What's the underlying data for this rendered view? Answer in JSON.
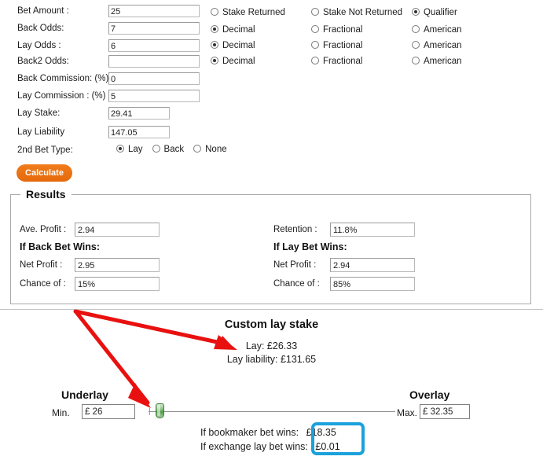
{
  "form": {
    "rows": [
      {
        "label": "Bet Amount :",
        "value": "25",
        "input_name": "bet-amount-input",
        "wide": false
      },
      {
        "label": "Back Odds:",
        "value": "7",
        "input_name": "back-odds-input",
        "wide": false
      },
      {
        "label": "Lay Odds :",
        "value": "6",
        "input_name": "lay-odds-input",
        "wide": false
      },
      {
        "label": "Back2 Odds:",
        "value": "",
        "input_name": "back2-odds-input",
        "wide": false
      },
      {
        "label": "Back Commission: (%)",
        "value": "0",
        "input_name": "back-commission-input",
        "wide": false
      },
      {
        "label": "Lay Commission : (%)",
        "value": "5",
        "input_name": "lay-commission-input",
        "wide": false
      },
      {
        "label": "Lay Stake:",
        "value": "29.41",
        "input_name": "lay-stake-input",
        "wide": true
      },
      {
        "label": "Lay Liability",
        "value": "147.05",
        "input_name": "lay-liability-input",
        "wide": true
      }
    ],
    "radio_rows": [
      {
        "a": "Stake Returned",
        "a_on": false,
        "b": "Stake Not Returned",
        "b_on": false,
        "c": "Qualifier",
        "c_on": true
      },
      {
        "a": "Decimal",
        "a_on": true,
        "b": "Fractional",
        "b_on": false,
        "c": "American",
        "c_on": false
      },
      {
        "a": "Decimal",
        "a_on": true,
        "b": "Fractional",
        "b_on": false,
        "c": "American",
        "c_on": false
      },
      {
        "a": "Decimal",
        "a_on": true,
        "b": "Fractional",
        "b_on": false,
        "c": "American",
        "c_on": false
      }
    ],
    "second_bet_type": {
      "label": "2nd Bet Type:",
      "options": [
        {
          "label": "Lay",
          "selected": true
        },
        {
          "label": "Back",
          "selected": false
        },
        {
          "label": "None",
          "selected": false
        }
      ]
    }
  },
  "calculate_button": {
    "label": "Calculate"
  },
  "results": {
    "legend": "Results",
    "left": {
      "ave_profit_label": "Ave. Profit :",
      "ave_profit_value": "2.94",
      "heading": "If Back Bet Wins:",
      "net_profit_label": "Net Profit :",
      "net_profit_value": "2.95",
      "chance_label": "Chance of :",
      "chance_value": "15%"
    },
    "right": {
      "retention_label": "Retention :",
      "retention_value": "11.8%",
      "heading": "If Lay Bet Wins:",
      "net_profit_label": "Net Profit :",
      "net_profit_value": "2.94",
      "chance_label": "Chance of :",
      "chance_value": "85%"
    }
  },
  "custom_lay_stake": {
    "title": "Custom lay stake",
    "lay_line": "Lay: £26.33",
    "liability_line": "Lay liability: £131.65"
  },
  "slider_section": {
    "underlay_title": "Underlay",
    "overlay_title": "Overlay",
    "min_label": "Min.",
    "min_value": "£  26",
    "max_label": "Max.",
    "max_value": "£  32.35"
  },
  "outcomes": {
    "bookmaker_label": "If bookmaker bet wins:",
    "bookmaker_value": "£18.35",
    "exchange_label": "If exchange lay bet wins:",
    "exchange_value": "£0.01"
  },
  "colors": {
    "accent_orange": "#ec7211",
    "highlight_blue": "#1ba1dc",
    "arrow_red": "#e8110f",
    "slider_green": "#4e9a46"
  }
}
